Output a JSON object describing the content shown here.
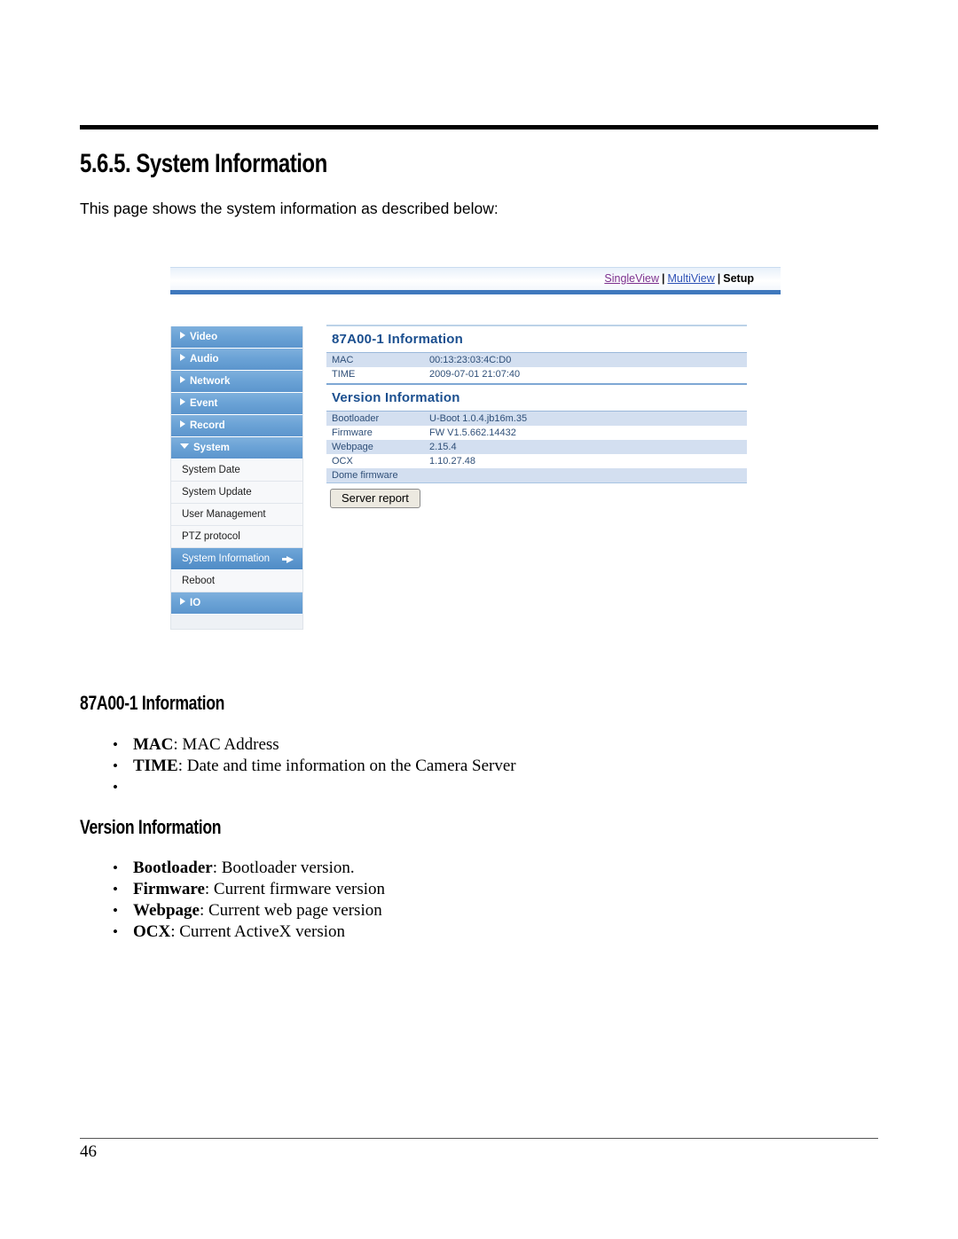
{
  "document": {
    "section_heading": "5.6.5. System Information",
    "intro": "This page shows the system information as described below:",
    "page_number": "46",
    "info_heading": "87A00-1 Information",
    "info_bullets": [
      {
        "term": "MAC",
        "desc": ": MAC Address"
      },
      {
        "term": "TIME",
        "desc": ": Date and time information on the Camera Server"
      },
      {
        "term": "",
        "desc": ""
      }
    ],
    "version_heading": "Version Information",
    "version_bullets": [
      {
        "term": "Bootloader",
        "desc": ": Bootloader version."
      },
      {
        "term": "Firmware",
        "desc": ": Current firmware version"
      },
      {
        "term": "Webpage",
        "desc": ": Current web page version"
      },
      {
        "term": "OCX",
        "desc": ": Current ActiveX version"
      }
    ]
  },
  "screenshot": {
    "topnav": {
      "single_view": "SingleView",
      "separator": "|",
      "multi_view": "MultiView",
      "setup": "Setup"
    },
    "sidebar": {
      "top_items": [
        {
          "label": "Video",
          "icon": "triangle-right-icon",
          "expanded": false
        },
        {
          "label": "Audio",
          "icon": "triangle-right-icon",
          "expanded": false
        },
        {
          "label": "Network",
          "icon": "triangle-right-icon",
          "expanded": false
        },
        {
          "label": "Event",
          "icon": "triangle-right-icon",
          "expanded": false
        },
        {
          "label": "Record",
          "icon": "triangle-right-icon",
          "expanded": false
        },
        {
          "label": "System",
          "icon": "triangle-down-icon",
          "expanded": true
        }
      ],
      "sub_items": [
        {
          "label": "System Date",
          "active": false
        },
        {
          "label": "System Update",
          "active": false
        },
        {
          "label": "User Management",
          "active": false
        },
        {
          "label": "PTZ protocol",
          "active": false
        },
        {
          "label": "System Information",
          "active": true,
          "icon": "arrow-right-icon"
        },
        {
          "label": "Reboot",
          "active": false
        }
      ],
      "bottom_items": [
        {
          "label": "IO",
          "icon": "triangle-right-icon",
          "expanded": false
        }
      ]
    },
    "panel": {
      "device_title": "87A00-1 Information",
      "device_rows": [
        {
          "key": "MAC",
          "value": "00:13:23:03:4C:D0"
        },
        {
          "key": "TIME",
          "value": "2009-07-01 21:07:40"
        }
      ],
      "version_title": "Version Information",
      "version_rows": [
        {
          "key": "Bootloader",
          "value": "U-Boot 1.0.4.jb16m.35"
        },
        {
          "key": "Firmware",
          "value": "FW V1.5.662.14432"
        },
        {
          "key": "Webpage",
          "value": "2.15.4"
        },
        {
          "key": "OCX",
          "value": "1.10.27.48"
        },
        {
          "key": "Dome firmware",
          "value": ""
        }
      ],
      "server_report_button": "Server report"
    }
  },
  "colors": {
    "accent_blue": "#3f78bd",
    "sidebar_blue": "#6ba3d6",
    "row_alt": "#d3dff0",
    "title_blue": "#1b4f8f",
    "visited_link": "#7b2f8e",
    "link": "#2a4fb5"
  }
}
